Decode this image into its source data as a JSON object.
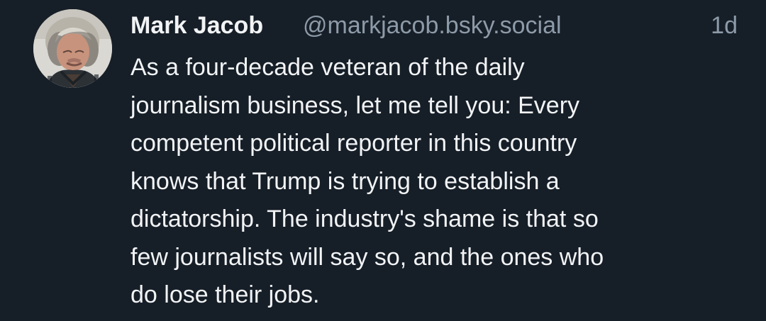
{
  "post": {
    "author": {
      "display_name": "Mark Jacob",
      "handle": "@markjacob.bsky.social",
      "avatar_icon": "profile-photo"
    },
    "timestamp": "1d",
    "text_lines": [
      "As a four-decade veteran of the daily",
      "journalism business, let me tell you: Every",
      "competent political reporter in this country",
      "knows that Trump is trying to establish a",
      "dictatorship. The industry's shame is that so",
      "few journalists will say so, and the ones who",
      "do lose their jobs."
    ]
  },
  "colors": {
    "background": "#161e27",
    "primary_text": "#f1f3f5",
    "secondary_text": "#8d9aa8"
  }
}
